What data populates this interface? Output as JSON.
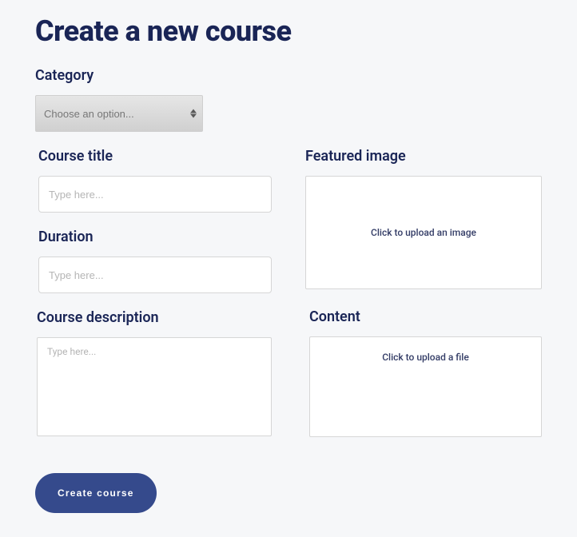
{
  "page": {
    "title": "Create a new course"
  },
  "form": {
    "category": {
      "label": "Category",
      "placeholder": "Choose an option..."
    },
    "courseTitle": {
      "label": "Course title",
      "placeholder": "Type here..."
    },
    "duration": {
      "label": "Duration",
      "placeholder": "Type here..."
    },
    "courseDescription": {
      "label": "Course description",
      "placeholder": "Type here..."
    },
    "featuredImage": {
      "label": "Featured image",
      "uploadText": "Click to upload an image"
    },
    "content": {
      "label": "Content",
      "uploadText": "Click to upload a file"
    },
    "submit": {
      "label": "Create course"
    }
  }
}
